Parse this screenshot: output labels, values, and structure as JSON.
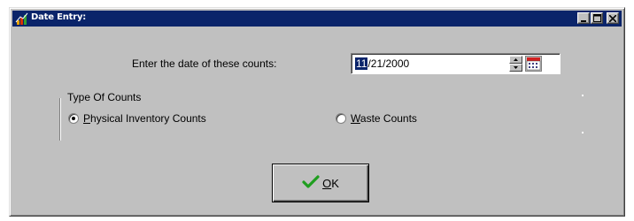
{
  "window": {
    "title": "Date Entry:",
    "title_icon": "app-chart-icon",
    "controls": [
      "minimize-icon",
      "maximize-icon",
      "close-icon"
    ]
  },
  "date_prompt": {
    "label": "Enter the date of these counts:",
    "selected_part": "11",
    "rest": "/21/2000",
    "spinner_icon": "spin-up-down-icon",
    "calendar_icon": "calendar-icon"
  },
  "count_type": {
    "group_label": "Type Of Counts",
    "options": [
      {
        "prefix": "",
        "mnemonic": "P",
        "suffix": "hysical Inventory Counts",
        "checked": true
      },
      {
        "prefix": "",
        "mnemonic": "W",
        "suffix": "aste Counts",
        "checked": false
      }
    ]
  },
  "ok_button": {
    "mnemonic": "O",
    "suffix": "K",
    "icon": "checkmark-icon"
  },
  "colors": {
    "titlebar": "#0a246a",
    "face": "#c0c0c0",
    "check_green": "#1f9e1f"
  }
}
